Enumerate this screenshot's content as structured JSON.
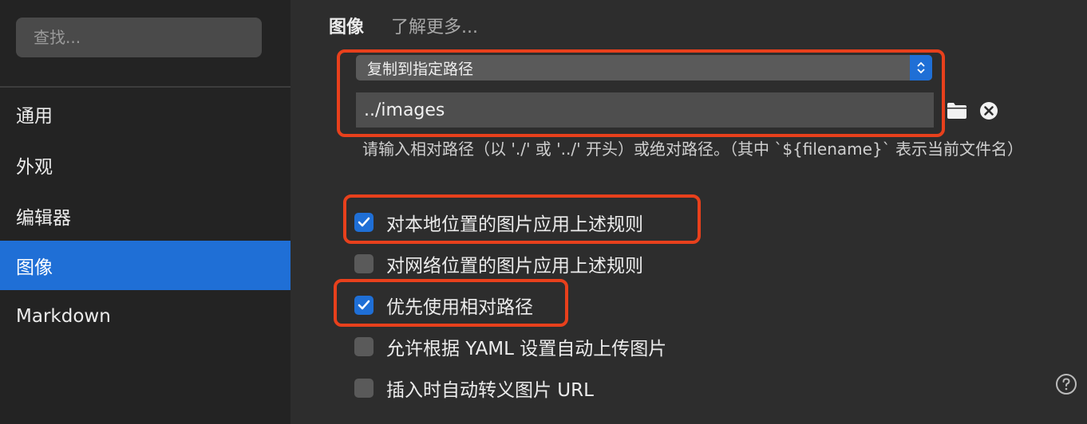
{
  "sidebar": {
    "search_placeholder": "查找...",
    "items": [
      {
        "label": "通用",
        "active": false
      },
      {
        "label": "外观",
        "active": false
      },
      {
        "label": "编辑器",
        "active": false
      },
      {
        "label": "图像",
        "active": true
      },
      {
        "label": "Markdown",
        "active": false
      }
    ]
  },
  "main": {
    "section_title": "图像",
    "learn_more": "了解更多...",
    "action_select": {
      "value": "复制到指定路径",
      "icon": "updown-chevron-icon"
    },
    "path_input": {
      "value": "../images"
    },
    "path_icons": [
      "folder-icon",
      "clear-icon"
    ],
    "hint": "请输入相对路径（以 './' 或 '../' 开头）或绝对路径。（其中 `${filename}` 表示当前文件名）",
    "options": [
      {
        "label": "对本地位置的图片应用上述规则",
        "checked": true
      },
      {
        "label": "对网络位置的图片应用上述规则",
        "checked": false
      },
      {
        "label": "优先使用相对路径",
        "checked": true
      },
      {
        "label": "允许根据 YAML 设置自动上传图片",
        "checked": false
      },
      {
        "label": "插入时自动转义图片 URL",
        "checked": false
      }
    ],
    "help_icon": "question-mark-icon"
  },
  "colors": {
    "accent": "#1f6fd6",
    "highlight": "#e8401c",
    "sidebar_bg": "#232323",
    "main_bg": "#2d2d2d"
  }
}
